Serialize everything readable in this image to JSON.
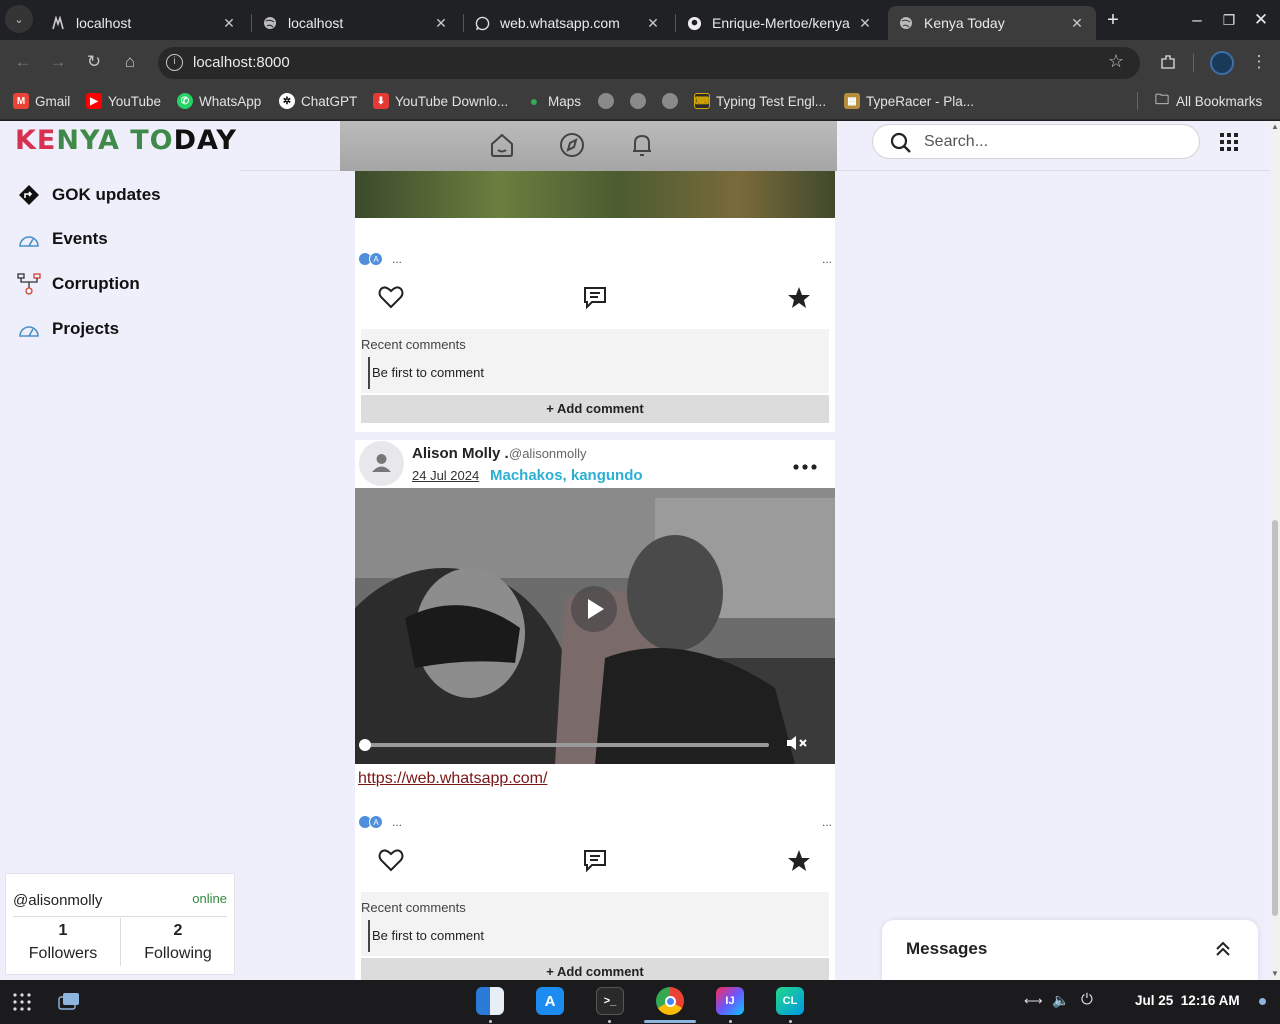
{
  "browser": {
    "tabs": [
      {
        "title": "localhost",
        "icon": "windmill-icon"
      },
      {
        "title": "localhost",
        "icon": "globe-icon"
      },
      {
        "title": "web.whatsapp.com",
        "icon": "whatsapp-icon"
      },
      {
        "title": "Enrique-Mertoe/kenya",
        "icon": "github-icon"
      },
      {
        "title": "Kenya Today",
        "icon": "globe-icon",
        "active": true
      }
    ],
    "url": "localhost:8000",
    "bookmarks": [
      {
        "label": "Gmail",
        "color": "#ea4335"
      },
      {
        "label": "YouTube",
        "color": "#ff0000"
      },
      {
        "label": "WhatsApp",
        "color": "#25d366"
      },
      {
        "label": "ChatGPT",
        "color": "#ffffff"
      },
      {
        "label": "YouTube Downlo...",
        "color": "#e53935"
      },
      {
        "label": "Maps",
        "color": "#34a853"
      },
      {
        "label": "",
        "color": "#8a8a8a"
      },
      {
        "label": "",
        "color": "#8a8a8a"
      },
      {
        "label": "",
        "color": "#8a8a8a"
      },
      {
        "label": "Typing Test Engl...",
        "color": "#2b2b2b"
      },
      {
        "label": "TypeRacer - Pla...",
        "color": "#b58d3d"
      }
    ],
    "all_bookmarks": "All Bookmarks"
  },
  "site": {
    "logo": {
      "k1": "KE",
      "k2": "NYA",
      "t1": "TO",
      "t2": "DAY"
    },
    "search_placeholder": "Search...",
    "nav": [
      {
        "label": "GOK updates",
        "icon": "diamond-arrow-icon"
      },
      {
        "label": "Events",
        "icon": "gauge-icon"
      },
      {
        "label": "Corruption",
        "icon": "hierarchy-icon"
      },
      {
        "label": "Projects",
        "icon": "gauge-icon"
      }
    ]
  },
  "posts": [
    {
      "reactions_more": "...",
      "menu_more": "...",
      "recent_comments_label": "Recent comments",
      "empty_comment": "Be first to comment",
      "add_comment": "+ Add comment"
    },
    {
      "author": "Alison Molly",
      "dot": ".",
      "handle": "@alisonmolly",
      "date": "24 Jul 2024",
      "location": "Machakos, kangundo",
      "link": "https://web.whatsapp.com/",
      "video_progress": 0,
      "reactions_more": "...",
      "menu_more": "...",
      "recent_comments_label": "Recent comments",
      "empty_comment": "Be first to comment",
      "add_comment": "+ Add comment"
    }
  ],
  "profile": {
    "handle": "@alisonmolly",
    "status": "online",
    "followers_count": "1",
    "followers_label": "Followers",
    "following_count": "2",
    "following_label": "Following"
  },
  "messages": {
    "title": "Messages"
  },
  "taskbar": {
    "date": "Jul 25",
    "time": "12:16 AM",
    "apps": [
      "finder",
      "app-store",
      "terminal",
      "chrome",
      "intellij",
      "clion"
    ]
  }
}
